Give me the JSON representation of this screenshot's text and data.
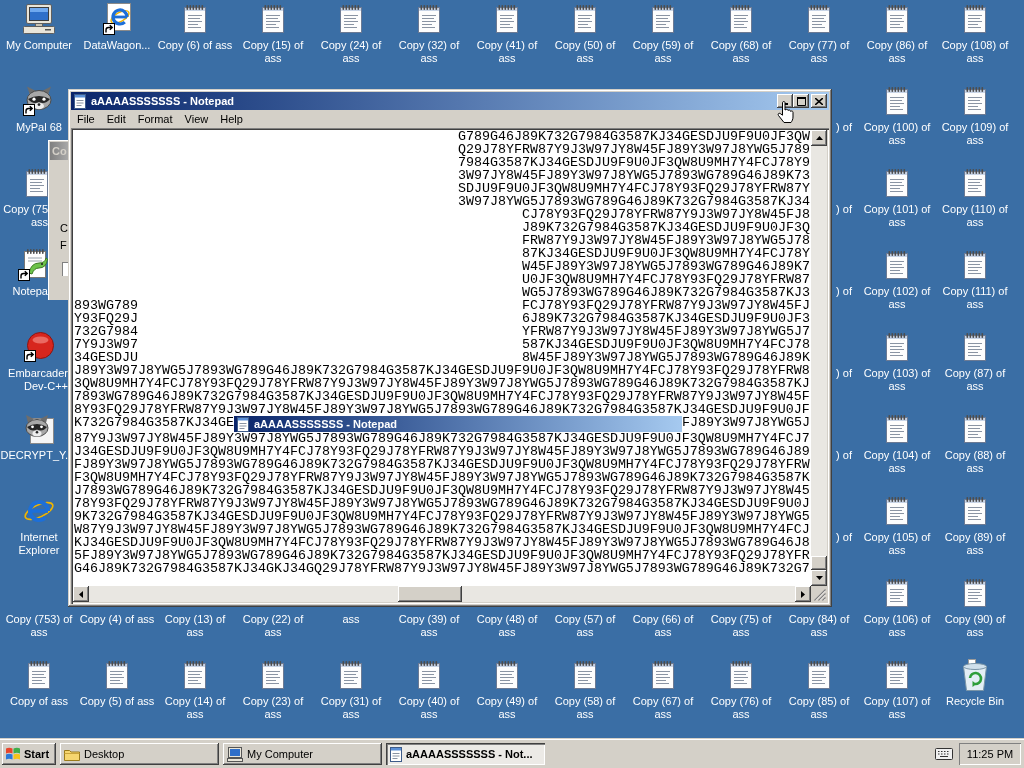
{
  "desktop": {
    "top_row": [
      {
        "label": "My Computer",
        "kind": "computer"
      },
      {
        "label": "DataWagon...",
        "kind": "browserlink"
      },
      {
        "label": "Copy (6) of ass",
        "kind": "document"
      },
      {
        "label": "Copy (15) of ass",
        "kind": "document"
      },
      {
        "label": "Copy (24) of ass",
        "kind": "document"
      },
      {
        "label": "Copy (32) of ass",
        "kind": "document"
      },
      {
        "label": "Copy (41) of ass",
        "kind": "document"
      },
      {
        "label": "Copy (50) of ass",
        "kind": "document"
      },
      {
        "label": "Copy (59) of ass",
        "kind": "document"
      },
      {
        "label": "Copy (68) of ass",
        "kind": "document"
      },
      {
        "label": "Copy (77) of ass",
        "kind": "document"
      },
      {
        "label": "Copy (86) of ass",
        "kind": "document"
      },
      {
        "label": "Copy (108) of ass",
        "kind": "document"
      }
    ],
    "left_column": [
      {
        "label": "MyPal 68",
        "kind": "raccoonlink",
        "clipped": false,
        "under_dialog": false
      },
      {
        "label": "Copy (75 ass",
        "kind": "document",
        "clipped": true,
        "under_dialog": true
      },
      {
        "label": "Notepa",
        "kind": "editorlink",
        "clipped": true,
        "under_dialog": true
      },
      {
        "label": "Embarcader Dev-C++",
        "kind": "devlink",
        "clipped": true,
        "under_dialog": false
      },
      {
        "label": "DECRYPT_Y.",
        "kind": "raccoondoc",
        "clipped": true,
        "under_dialog": false
      },
      {
        "label": "Internet Explorer",
        "kind": "browser",
        "clipped": false,
        "under_dialog": false
      }
    ],
    "partly_hidden_labels": [
      ") of",
      ") of",
      ") of",
      ") of",
      ") of",
      ") of"
    ],
    "right_columns": [
      [
        {
          "label": "Copy (100) of ass",
          "kind": "document"
        },
        {
          "label": "Copy (101) of ass",
          "kind": "document"
        },
        {
          "label": "Copy (102) of ass",
          "kind": "document"
        },
        {
          "label": "Copy (103) of ass",
          "kind": "document"
        },
        {
          "label": "Copy (104) of ass",
          "kind": "document"
        },
        {
          "label": "Copy (105) of ass",
          "kind": "document"
        },
        {
          "label": "Copy (106) of ass",
          "kind": "document"
        },
        {
          "label": "Copy (107) of ass",
          "kind": "document"
        }
      ],
      [
        {
          "label": "Copy (109) of ass",
          "kind": "document"
        },
        {
          "label": "Copy (110) of ass",
          "kind": "document"
        },
        {
          "label": "Copy (111) of ass",
          "kind": "document"
        },
        {
          "label": "Copy (87) of ass",
          "kind": "document"
        },
        {
          "label": "Copy (88) of ass",
          "kind": "document"
        },
        {
          "label": "Copy (89) of ass",
          "kind": "document"
        },
        {
          "label": "Copy (90) of ass",
          "kind": "document"
        },
        {
          "label": "Recycle Bin",
          "kind": "recycle"
        }
      ]
    ],
    "bottom_rows": [
      [
        {
          "label": "Copy (753) of ass",
          "kind": "none"
        },
        {
          "label": "Copy (4) of ass",
          "kind": "none"
        },
        {
          "label": "Copy (13) of ass",
          "kind": "none"
        },
        {
          "label": "Copy (22) of ass",
          "kind": "none"
        },
        {
          "label": "ass",
          "kind": "none"
        },
        {
          "label": "Copy (39) of ass",
          "kind": "none"
        },
        {
          "label": "Copy (48) of ass",
          "kind": "none"
        },
        {
          "label": "Copy (57) of ass",
          "kind": "none"
        },
        {
          "label": "Copy (66) of ass",
          "kind": "none"
        },
        {
          "label": "Copy (75) of ass",
          "kind": "none"
        },
        {
          "label": "Copy (84) of ass",
          "kind": "none"
        }
      ],
      [
        {
          "label": "Copy of ass",
          "kind": "document"
        },
        {
          "label": "Copy (5) of ass",
          "kind": "document"
        },
        {
          "label": "Copy (14) of ass",
          "kind": "document"
        },
        {
          "label": "Copy (23) of ass",
          "kind": "document"
        },
        {
          "label": "Copy (31) of ass",
          "kind": "document"
        },
        {
          "label": "Copy (40) of ass",
          "kind": "document"
        },
        {
          "label": "Copy (49) of ass",
          "kind": "document"
        },
        {
          "label": "Copy (58) of ass",
          "kind": "document"
        },
        {
          "label": "Copy (67) of ass",
          "kind": "document"
        },
        {
          "label": "Copy (76) of ass",
          "kind": "document"
        },
        {
          "label": "Copy (85) of ass",
          "kind": "document"
        }
      ]
    ]
  },
  "background_dialog": {
    "title": "Co",
    "labels": [
      "C",
      "F"
    ]
  },
  "notepad": {
    "title": "aAAAASSSSSSS - Notepad",
    "menu": [
      "File",
      "Edit",
      "Format",
      "View",
      "Help"
    ],
    "lines": [
      {
        "kind": "right",
        "parts": [
          "G789G46J89K732G7984G3587KJ34GESDJU9F9U0JF3QW"
        ]
      },
      {
        "kind": "right",
        "parts": [
          "Q29J78YFRW87Y9J3W97JY8W45FJ89Y3W97J8YWG5J789"
        ]
      },
      {
        "kind": "right",
        "parts": [
          "7984G3587KJ34GESDJU9F9U0JF3QW8U9MH7Y4FCJ78Y9"
        ]
      },
      {
        "kind": "right",
        "parts": [
          "3W97JY8W45FJ89Y3W97J8YWG5J7893WG789G46J89K73"
        ]
      },
      {
        "kind": "right",
        "parts": [
          "SDJU9F9U0JF3QW8U9MH7Y4FCJ78Y93FQ29J78YFRW87Y"
        ]
      },
      {
        "kind": "right",
        "parts": [
          "3W97J8YWG5J7893WG789G46J89K732G7984G3587KJ34"
        ]
      },
      {
        "kind": "end",
        "parts": [
          "CJ78Y93FQ29J78YFRW87Y9J3W97JY8W45FJ8"
        ]
      },
      {
        "kind": "end",
        "parts": [
          "J89K732G7984G3587KJ34GESDJU9F9U0JF3Q"
        ]
      },
      {
        "kind": "end",
        "parts": [
          "FRW87Y9J3W97JY8W45FJ89Y3W97J8YWG5J78"
        ]
      },
      {
        "kind": "end",
        "parts": [
          "87KJ34GESDJU9F9U0JF3QW8U9MH7Y4FCJ78Y"
        ]
      },
      {
        "kind": "end",
        "parts": [
          "W45FJ89Y3W97J8YWG5J7893WG789G46J89K7"
        ]
      },
      {
        "kind": "end",
        "parts": [
          "U0JF3QW8U9MH7Y4FCJ78Y93FQ29J78YFRW87"
        ]
      },
      {
        "kind": "end",
        "parts": [
          "WG5J7893WG789G46J89K732G7984G3587KJ3"
        ]
      },
      {
        "kind": "split",
        "parts": [
          "893WG789",
          "FCJ78Y93FQ29J78YFRW87Y9J3W97JY8W45FJ"
        ]
      },
      {
        "kind": "split",
        "parts": [
          "Y93FQ29J",
          "6J89K732G7984G3587KJ34GESDJU9F9U0JF3"
        ]
      },
      {
        "kind": "split",
        "parts": [
          "732G7984",
          "YFRW87Y9J3W97JY8W45FJ89Y3W97J8YWG5J7"
        ]
      },
      {
        "kind": "split",
        "parts": [
          "7Y9J3W97",
          "587KJ34GESDJU9F9U0JF3QW8U9MH7Y4FCJ78"
        ]
      },
      {
        "kind": "split",
        "parts": [
          "34GESDJU",
          "8W45FJ89Y3W97J8YWG5J7893WG789G46J89K"
        ]
      },
      {
        "kind": "full",
        "parts": [
          "J89Y3W97J8YWG5J7893WG789G46J89K732G7984G3587KJ34GESDJU9F9U0JF3QW8U9MH7Y4FCJ78Y93FQ29J78YFRW8"
        ]
      },
      {
        "kind": "full",
        "parts": [
          "3QW8U9MH7Y4FCJ78Y93FQ29J78YFRW87Y9J3W97JY8W45FJ89Y3W97J8YWG5J7893WG789G46J89K732G7984G3587KJ"
        ]
      },
      {
        "kind": "full",
        "parts": [
          "7893WG789G46J89K732G7984G3587KJ34GESDJU9F9U0JF3QW8U9MH7Y4FCJ78Y93FQ29J78YFRW87Y9J3W97JY8W45F"
        ]
      },
      {
        "kind": "full",
        "parts": [
          "8Y93FQ29J78YFRW87Y9J3W97JY8W45FJ89Y3W97J8YWG5J7893WG789G46J89K732G7984G3587KJ34GESDJU9F9U0JF"
        ]
      },
      {
        "kind": "covered",
        "parts": [
          "K732G7984G3587KJ34GE",
          "FJ89Y3W97J8YWG5J"
        ],
        "overlay_title": "aAAAASSSSSSS - Notepad"
      },
      {
        "kind": "full",
        "parts": [
          "87Y9J3W97JY8W45FJ89Y3W97J8YWG5J7893WG789G46J89K732G7984G3587KJ34GESDJU9F9U0JF3QW8U9MH7Y4FCJ7"
        ]
      },
      {
        "kind": "full",
        "parts": [
          "J34GESDJU9F9U0JF3QW8U9MH7Y4FCJ78Y93FQ29J78YFRW87Y9J3W97JY8W45FJ89Y3W97J8YWG5J7893WG789G46J89"
        ]
      },
      {
        "kind": "full",
        "parts": [
          "FJ89Y3W97J8YWG5J7893WG789G46J89K732G7984G3587KJ34GESDJU9F9U0JF3QW8U9MH7Y4FCJ78Y93FQ29J78YFRW"
        ]
      },
      {
        "kind": "full",
        "parts": [
          "F3QW8U9MH7Y4FCJ78Y93FQ29J78YFRW87Y9J3W97JY8W45FJ89Y3W97J8YWG5J7893WG789G46J89K732G7984G3587K"
        ]
      },
      {
        "kind": "full",
        "parts": [
          "J7893WG789G46J89K732G7984G3587KJ34GESDJU9F9U0JF3QW8U9MH7Y4FCJ78Y93FQ29J78YFRW87Y9J3W97JY8W45"
        ]
      },
      {
        "kind": "full",
        "parts": [
          "78Y93FQ29J78YFRW87Y9J3W97JY8W45FJ89Y3W97J8YWG5J7893WG789G46J89K732G7984G3587KJ34GESDJU9F9U0J"
        ]
      },
      {
        "kind": "full",
        "parts": [
          "9K732G7984G3587KJ34GESDJU9F9U0JF3QW8U9MH7Y4FCJ78Y93FQ29J78YFRW87Y9J3W97JY8W45FJ89Y3W97J8YWG5"
        ]
      },
      {
        "kind": "full",
        "parts": [
          "W87Y9J3W97JY8W45FJ89Y3W97J8YWG5J7893WG789G46J89K732G7984G3587KJ34GESDJU9F9U0JF3QW8U9MH7Y4FCJ"
        ]
      },
      {
        "kind": "full",
        "parts": [
          "KJ34GESDJU9F9U0JF3QW8U9MH7Y4FCJ78Y93FQ29J78YFRW87Y9J3W97JY8W45FJ89Y3W97J8YWG5J7893WG789G46J8"
        ]
      },
      {
        "kind": "full",
        "parts": [
          "5FJ89Y3W97J8YWG5J7893WG789G46J89K732G7984G3587KJ34GESDJU9F9U0JF3QW8U9MH7Y4FCJ78Y93FQ29J78YFR"
        ]
      },
      {
        "kind": "full",
        "parts": [
          "G46J89K732G7984G3587KJ34GKJ34GQ29J78YFRW87Y9J3W97JY8W45FJ89Y3W97J8YWG5J7893WG789G46J89K732G7"
        ]
      }
    ]
  },
  "taskbar": {
    "start": "Start",
    "tasks": [
      {
        "label": "Desktop",
        "kind": "folder",
        "selected": false
      },
      {
        "label": "My Computer",
        "kind": "computer",
        "selected": false
      },
      {
        "label": "aAAAASSSSSSS - Not...",
        "kind": "notepad",
        "selected": true
      }
    ],
    "clock": "11:25 PM"
  }
}
